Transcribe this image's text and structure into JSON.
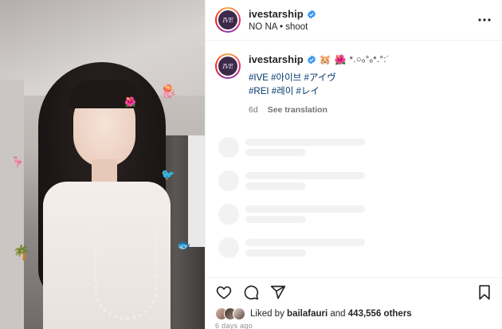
{
  "header": {
    "username": "ivestarship",
    "subtitle": "NO NA • shoot",
    "avatar_mark": "IVE"
  },
  "caption": {
    "username": "ivestarship",
    "emojis": [
      "🐹",
      "🌺"
    ],
    "kaomoji": "*.○ₒ°ₒ*.°:˙",
    "hashtags_line1": "#IVE #아이브 #アイヴ",
    "hashtags_line2": "#REI #레이 #レイ",
    "time_ago": "6d",
    "see_translation": "See translation"
  },
  "media": {
    "stickers": [
      "🪼",
      "🦩",
      "🐦",
      "🌴",
      "🐟"
    ]
  },
  "actions": {
    "like_icon": "heart-icon",
    "comment_icon": "comment-icon",
    "share_icon": "share-icon",
    "save_icon": "bookmark-icon"
  },
  "likes": {
    "prefix": "Liked by",
    "user": "bailafauri",
    "conjunction": "and",
    "count_text": "443,556 others"
  },
  "date": "6 days ago",
  "colors": {
    "hashtag": "#00376b",
    "verified": "#3897f0",
    "muted": "#737373"
  }
}
